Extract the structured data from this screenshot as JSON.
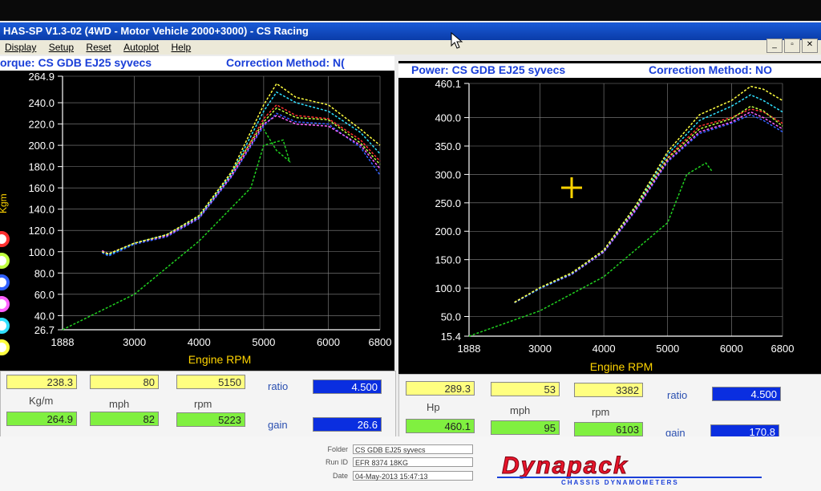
{
  "window": {
    "title": "HAS-SP V1.3-02  (4WD - Motor Vehicle 2000+3000) - CS Racing",
    "menu": [
      "Display",
      "Setup",
      "Reset",
      "Autoplot",
      "Help"
    ]
  },
  "torque_plot": {
    "title": "orque: CS GDB EJ25 syvecs",
    "method": "Correction Method: N(",
    "unit": "Kgm",
    "xlabel": "Engine RPM",
    "y_ticks": [
      "264.9",
      "240.0",
      "220.0",
      "200.0",
      "180.0",
      "160.0",
      "140.0",
      "120.0",
      "100.0",
      "80.0",
      "60.0",
      "40.0",
      "26.7"
    ],
    "x_ticks": [
      "1888",
      "3000",
      "4000",
      "5000",
      "6000",
      "6800"
    ]
  },
  "power_plot": {
    "title": "Power: CS GDB EJ25 syvecs",
    "method": "Correction Method: NO",
    "unit": "Hp",
    "xlabel": "Engine RPM",
    "y_ticks": [
      "460.1",
      "400.0",
      "350.0",
      "300.0",
      "250.0",
      "200.0",
      "150.0",
      "100.0",
      "50.0",
      "15.4"
    ],
    "x_ticks": [
      "1888",
      "3000",
      "4000",
      "5000",
      "6000",
      "6800"
    ]
  },
  "chart_data": [
    {
      "type": "line",
      "title": "orque: CS GDB EJ25 syvecs",
      "xlabel": "Engine RPM",
      "ylabel": "Kgm",
      "xlim": [
        1888,
        6800
      ],
      "ylim": [
        26.7,
        264.9
      ],
      "grid": true,
      "series": [
        {
          "color": "#ff3030",
          "x": [
            2500,
            2600,
            3000,
            3500,
            4000,
            4500,
            5000,
            5200,
            5500,
            6000,
            6500,
            6800
          ],
          "y": [
            100,
            97,
            108,
            115,
            132,
            172,
            225,
            238,
            228,
            225,
            205,
            185
          ]
        },
        {
          "color": "#c0ff40",
          "x": [
            2500,
            2600,
            3000,
            3500,
            4000,
            4500,
            5000,
            5200,
            5500,
            6000,
            6500,
            6800
          ],
          "y": [
            100,
            98,
            108,
            116,
            134,
            174,
            222,
            235,
            226,
            224,
            202,
            182
          ]
        },
        {
          "color": "#3060ff",
          "x": [
            2500,
            2600,
            3000,
            3500,
            4000,
            4500,
            5000,
            5200,
            5500,
            6000,
            6500,
            6800
          ],
          "y": [
            99,
            96,
            107,
            114,
            131,
            170,
            218,
            230,
            222,
            220,
            198,
            172
          ]
        },
        {
          "color": "#ff60ff",
          "x": [
            2500,
            2600,
            3000,
            3500,
            4000,
            4500,
            5000,
            5200,
            5500,
            6000,
            6500,
            6800
          ],
          "y": [
            101,
            98,
            108,
            115,
            132,
            171,
            220,
            228,
            220,
            218,
            200,
            178
          ]
        },
        {
          "color": "#30e0ff",
          "x": [
            2500,
            2600,
            3000,
            3500,
            4000,
            4500,
            5000,
            5200,
            5500,
            6000,
            6500,
            6800
          ],
          "y": [
            100,
            97,
            108,
            116,
            133,
            173,
            232,
            250,
            240,
            232,
            212,
            192
          ]
        },
        {
          "color": "#ffff40",
          "x": [
            2500,
            2600,
            3000,
            3500,
            4000,
            4500,
            5000,
            5200,
            5500,
            6000,
            6500,
            6800
          ],
          "y": [
            100,
            98,
            108,
            116,
            134,
            175,
            238,
            258,
            245,
            238,
            215,
            200
          ]
        },
        {
          "color": "#20d020",
          "x": [
            1888,
            3000,
            4000,
            4800,
            5000,
            5300,
            5400,
            5200,
            5000
          ],
          "y": [
            26.7,
            60,
            110,
            160,
            200,
            205,
            185,
            195,
            215
          ]
        }
      ]
    },
    {
      "type": "line",
      "title": "Power: CS GDB EJ25 syvecs",
      "xlabel": "Engine RPM",
      "ylabel": "Hp",
      "xlim": [
        1888,
        6800
      ],
      "ylim": [
        15.4,
        460.1
      ],
      "grid": true,
      "series": [
        {
          "color": "#ff3030",
          "x": [
            2600,
            3000,
            3500,
            4000,
            4500,
            5000,
            5500,
            6000,
            6300,
            6500,
            6800
          ],
          "y": [
            75,
            100,
            125,
            165,
            240,
            330,
            385,
            400,
            415,
            410,
            390
          ]
        },
        {
          "color": "#c0ff40",
          "x": [
            2600,
            3000,
            3500,
            4000,
            4500,
            5000,
            5500,
            6000,
            6300,
            6500,
            6800
          ],
          "y": [
            75,
            100,
            126,
            166,
            242,
            328,
            380,
            398,
            420,
            412,
            385
          ]
        },
        {
          "color": "#3060ff",
          "x": [
            2600,
            3000,
            3500,
            4000,
            4500,
            5000,
            5500,
            6000,
            6300,
            6500,
            6800
          ],
          "y": [
            74,
            99,
            124,
            163,
            236,
            322,
            372,
            390,
            405,
            395,
            375
          ]
        },
        {
          "color": "#ff60ff",
          "x": [
            2600,
            3000,
            3500,
            4000,
            4500,
            5000,
            5500,
            6000,
            6300,
            6500,
            6800
          ],
          "y": [
            75,
            100,
            125,
            164,
            238,
            324,
            375,
            392,
            410,
            400,
            380
          ]
        },
        {
          "color": "#30e0ff",
          "x": [
            2600,
            3000,
            3500,
            4000,
            4500,
            5000,
            5500,
            6000,
            6300,
            6500,
            6800
          ],
          "y": [
            75,
            100,
            126,
            166,
            243,
            335,
            395,
            420,
            440,
            430,
            410
          ]
        },
        {
          "color": "#ffff40",
          "x": [
            2600,
            3000,
            3500,
            4000,
            4500,
            5000,
            5500,
            6000,
            6300,
            6500,
            6800
          ],
          "y": [
            75,
            101,
            127,
            167,
            245,
            340,
            405,
            430,
            455,
            450,
            430
          ]
        },
        {
          "color": "#20d020",
          "x": [
            1888,
            3000,
            4000,
            5000,
            5300,
            5600,
            5700
          ],
          "y": [
            15.4,
            60,
            120,
            215,
            300,
            320,
            305
          ]
        }
      ]
    }
  ],
  "left_readout": {
    "torque_val": "238.3",
    "mph_val": "80",
    "rpm_val": "5150",
    "ratio_label": "ratio",
    "ratio_val": "4.500",
    "unit_label": "Kg/m",
    "mph_label": "mph",
    "rpm_label": "rpm",
    "torque_peak": "264.9",
    "mph_peak": "82",
    "rpm_peak": "5223",
    "gain_label": "gain",
    "gain_val": "26.6"
  },
  "right_readout": {
    "power_val": "289.3",
    "mph_val": "53",
    "rpm_val": "3382",
    "ratio_label": "ratio",
    "ratio_val": "4.500",
    "unit_label": "Hp",
    "mph_label": "mph",
    "rpm_label": "rpm",
    "power_peak": "460.1",
    "mph_peak": "95",
    "rpm_peak": "6103",
    "gain_label": "gain",
    "gain_val": "170.8"
  },
  "footer": {
    "folder_label": "Folder",
    "folder_val": "CS GDB EJ25 syvecs",
    "runid_label": "Run ID",
    "runid_val": "EFR 8374 18KG",
    "date_label": "Date",
    "date_val": "04-May-2013  15:47:13",
    "logo_text": "Dynapack",
    "logo_sub": "CHASSIS    DYNAMOMETERS"
  },
  "legend_colors": [
    "#ff3030",
    "#c0ff40",
    "#3060ff",
    "#ff60ff",
    "#30e0ff",
    "#ffff40"
  ]
}
